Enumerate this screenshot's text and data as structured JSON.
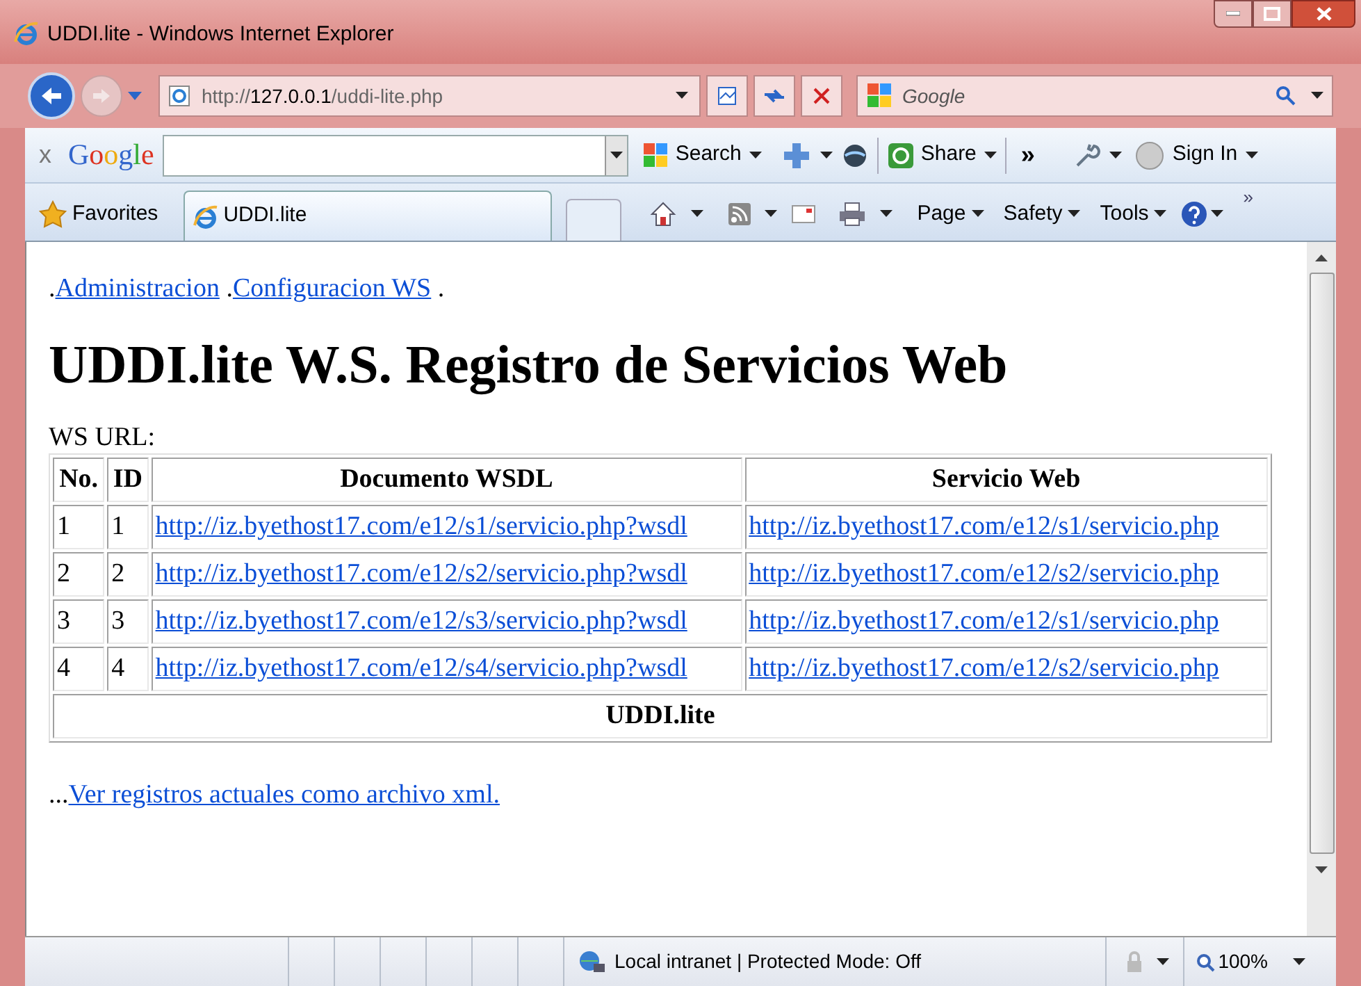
{
  "window": {
    "title": "UDDI.lite - Windows Internet Explorer"
  },
  "address_bar": {
    "scheme": "http://",
    "host": "127.0.0.1",
    "path": "/uddi-lite.php"
  },
  "search_box": {
    "placeholder": "Google"
  },
  "google_toolbar": {
    "close": "x",
    "logo": "Google",
    "search": "Search",
    "share": "Share",
    "more": "»",
    "sign_in": "Sign In"
  },
  "command_bar": {
    "favorites": "Favorites",
    "tabs": [
      {
        "label": "UDDI.lite",
        "selected": true
      }
    ],
    "menus": [
      "Page",
      "Safety",
      "Tools"
    ],
    "overflow": "»"
  },
  "page": {
    "nav": [
      {
        "prefix": ".",
        "link": "Administracion"
      },
      {
        "prefix": " .",
        "link": "Configuracion WS"
      }
    ],
    "nav_end": " .",
    "heading": "UDDI.lite W.S. Registro de Servicios Web",
    "label": "WS URL:",
    "table": {
      "columns": [
        "No.",
        "ID",
        "Documento WSDL",
        "Servicio Web"
      ],
      "rows": [
        [
          "1",
          "1",
          "http://iz.byethost17.com/e12/s1/servicio.php?wsdl",
          "http://iz.byethost17.com/e12/s1/servicio.php"
        ],
        [
          "2",
          "2",
          "http://iz.byethost17.com/e12/s2/servicio.php?wsdl",
          "http://iz.byethost17.com/e12/s2/servicio.php"
        ],
        [
          "3",
          "3",
          "http://iz.byethost17.com/e12/s3/servicio.php?wsdl",
          "http://iz.byethost17.com/e12/s1/servicio.php"
        ],
        [
          "4",
          "4",
          "http://iz.byethost17.com/e12/s4/servicio.php?wsdl",
          "http://iz.byethost17.com/e12/s2/servicio.php"
        ]
      ],
      "footer": "UDDI.lite"
    },
    "footer_prefix": "...",
    "footer_link": "Ver registros actuales como archivo xml."
  },
  "status_bar": {
    "zone": "Local intranet | Protected Mode: Off",
    "zoom": "100%"
  }
}
